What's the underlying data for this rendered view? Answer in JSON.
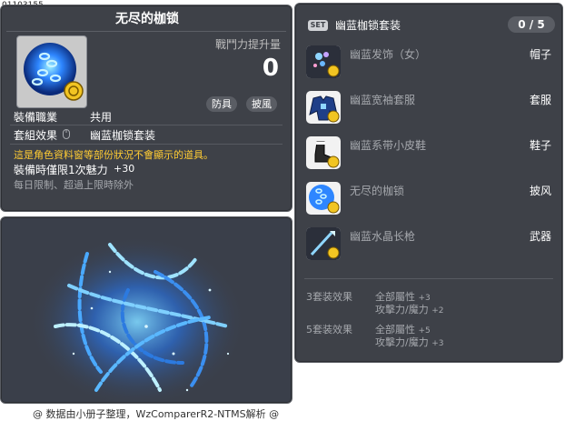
{
  "item_id": "01103155",
  "tooltip": {
    "title": "无尽的枷锁",
    "combat_power_label": "戰鬥力提升量",
    "combat_power_value": "0",
    "tags": [
      "防具",
      "披風"
    ],
    "job_label": "裝備職業",
    "job_value": "共用",
    "set_effect_label": "套組效果",
    "set_effect_value": "幽蓝枷锁套装",
    "warning": "這是角色資料窗等部份狀況不會顯示的道具。",
    "time_limit_label": "裝備時僅限1次魅力",
    "time_limit_value": "+30",
    "daily_limit": "每日限制、超過上限時除外"
  },
  "set_panel": {
    "badge": "SET",
    "name": "幽蓝枷锁套装",
    "count": "0 / 5",
    "items": [
      {
        "name": "幽蓝发饰（女）",
        "slot": "帽子",
        "icon": "hair-accessory-icon"
      },
      {
        "name": "幽蓝宽袖套服",
        "slot": "套服",
        "icon": "robe-icon"
      },
      {
        "name": "幽蓝系带小皮鞋",
        "slot": "鞋子",
        "icon": "shoe-icon"
      },
      {
        "name": "无尽的枷锁",
        "slot": "披风",
        "icon": "chain-cape-icon"
      },
      {
        "name": "幽蓝水晶长枪",
        "slot": "武器",
        "icon": "spear-icon"
      }
    ],
    "bonuses": [
      {
        "label": "3套装效果",
        "stats": [
          {
            "name": "全部屬性",
            "value": "+3"
          },
          {
            "name": "攻擊力/魔力",
            "value": "+2"
          }
        ]
      },
      {
        "label": "5套装效果",
        "stats": [
          {
            "name": "全部屬性",
            "value": "+5"
          },
          {
            "name": "攻擊力/魔力",
            "value": "+3"
          }
        ]
      }
    ]
  },
  "footer": "@ 数据由小册子整理，WzComparerR2-NTMS解析 @",
  "colors": {
    "panel_bg": "#3e4148",
    "warning": "#ffcc33",
    "muted": "#a5a8ad"
  }
}
